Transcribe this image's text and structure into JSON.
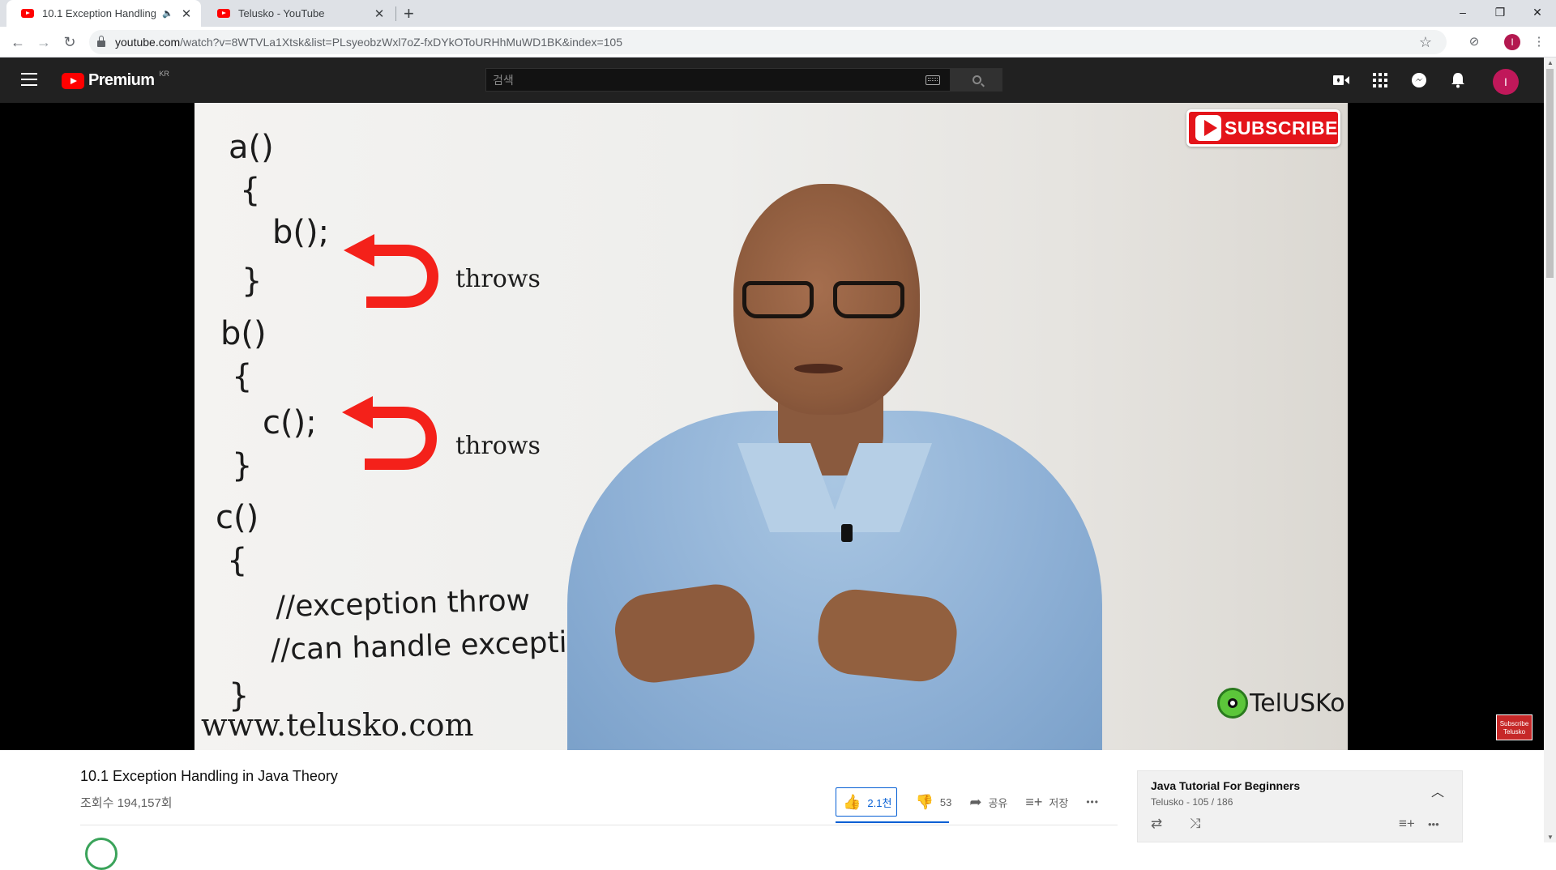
{
  "browser": {
    "tabs": [
      {
        "title": "10.1 Exception Handling in",
        "audio": "🔈",
        "active": true
      },
      {
        "title": "Telusko - YouTube",
        "active": false
      }
    ],
    "new_tab": "+",
    "url_host": "youtube.com",
    "url_path": "/watch?v=8WTVLa1Xtsk&list=PLsyeobzWxl7oZ-fxDYkOToURHhMuWD1BK&index=105",
    "profile_initial": "I",
    "window_controls": {
      "minimize": "–",
      "restore": "❐",
      "close": "✕"
    }
  },
  "masthead": {
    "logo_text": "Premium",
    "country": "KR",
    "search_placeholder": "검색",
    "avatar_initial": "I"
  },
  "video_frame": {
    "code_lines": [
      "a()",
      "{",
      "b();",
      "}",
      "b()",
      "{",
      "c();",
      "}",
      "c()",
      "{",
      "}"
    ],
    "throws_labels": [
      "throws",
      "throws"
    ],
    "comments": [
      "//exception throw",
      "//can handle exception"
    ],
    "website": "www.telusko.com",
    "subscribe_label": "SUBSCRIBE",
    "brand_logo": "TelUSKo",
    "end_card": "Subscribe Telusko"
  },
  "video": {
    "title": "10.1 Exception Handling in Java Theory",
    "views": "조회수 194,157회",
    "likes": "2.1천",
    "dislikes": "53",
    "share_label": "공유",
    "save_label": "저장",
    "more_label": "•••"
  },
  "playlist": {
    "title": "Java Tutorial For Beginners",
    "subtitle": "Telusko - 105 / 186"
  },
  "colors": {
    "brand_red": "#ff0000",
    "masthead_bg": "#212121",
    "like_blue": "#065fd4",
    "subscribe_red": "#e4141a"
  }
}
